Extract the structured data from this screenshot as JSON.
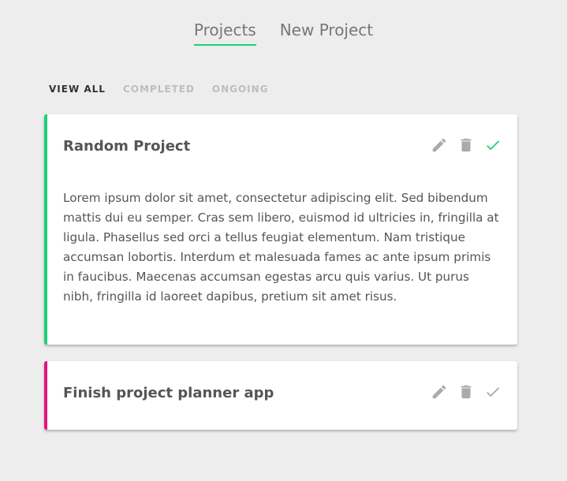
{
  "nav": {
    "projects_label": "Projects",
    "new_project_label": "New Project"
  },
  "filters": {
    "view_all": "VIEW ALL",
    "completed": "COMPLETED",
    "ongoing": "ONGOING",
    "active": "view_all"
  },
  "colors": {
    "accent_green": "#1bd07a",
    "accent_pink": "#e0157e",
    "check_completed": "#1bd07a",
    "check_pending": "#aaaaaa"
  },
  "projects": [
    {
      "title": "Random Project",
      "status": "completed",
      "expanded": true,
      "details": "Lorem ipsum dolor sit amet, consectetur adipiscing elit. Sed bibendum mattis dui eu semper. Cras sem libero, euismod id ultricies in, fringilla at ligula. Phasellus sed orci a tellus feugiat elementum. Nam tristique accumsan lobortis. Interdum et malesuada fames ac ante ipsum primis in faucibus. Maecenas accumsan egestas arcu quis varius. Ut purus nibh, fringilla id laoreet dapibus, pretium sit amet risus.",
      "icons": [
        "edit-icon",
        "delete-icon",
        "check-icon"
      ]
    },
    {
      "title": "Finish project planner app",
      "status": "ongoing",
      "expanded": false,
      "icons": [
        "edit-icon",
        "delete-icon",
        "check-icon"
      ]
    }
  ]
}
